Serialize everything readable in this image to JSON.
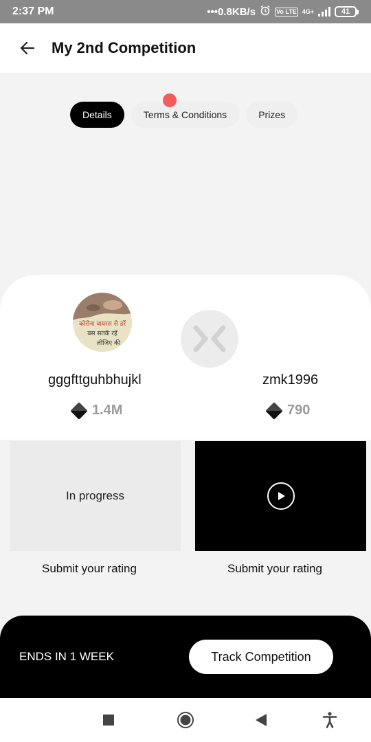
{
  "status_bar": {
    "time": "2:37 PM",
    "network_speed": "•••0.8KB/s",
    "volte_label": "Vo LTE",
    "network_type": "4G+",
    "battery": "41",
    "icons": [
      "alarm-icon",
      "volte-icon",
      "signal-icon",
      "battery-icon"
    ]
  },
  "header": {
    "title": "My 2nd Competition",
    "back_icon": "arrow-left-icon"
  },
  "tabs": [
    {
      "label": "Details",
      "active": true
    },
    {
      "label": "Terms & Conditions",
      "active": false,
      "notification_dot": true
    },
    {
      "label": "Prizes",
      "active": false
    }
  ],
  "competitors": {
    "left": {
      "name": "gggfttguhbhujkl",
      "score": "1.4M",
      "avatar_text_lines": [
        "कोरोना वायरस से डरें",
        "बस सतर्क रहें",
        "लीजिए की"
      ]
    },
    "right": {
      "name": "zmk1996",
      "score": "790"
    },
    "vs_icon": "versus-icon"
  },
  "entries": {
    "left": {
      "status": "In progress",
      "rating_label": "Submit your rating"
    },
    "right": {
      "play_icon": "play-icon",
      "rating_label": "Submit your rating"
    }
  },
  "bottom_bar": {
    "ends_label": "ENDS IN 1 WEEK",
    "track_button": "Track Competition"
  },
  "system_nav": [
    "recents-square-icon",
    "home-circle-icon",
    "back-triangle-icon",
    "accessibility-icon"
  ],
  "colors": {
    "accent_dot": "#f25c5c",
    "status_bar": "#8a8a8a",
    "black": "#000000"
  }
}
